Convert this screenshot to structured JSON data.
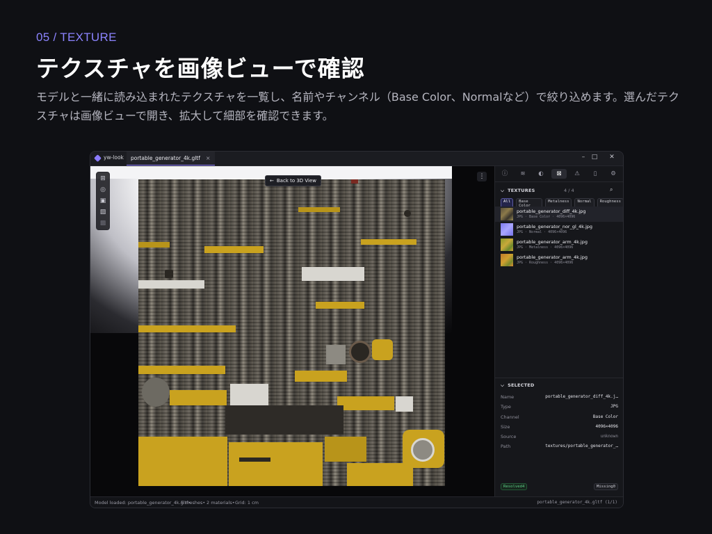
{
  "hero": {
    "kicker": "05 / TEXTURE",
    "title": "テクスチャを画像ビューで確認",
    "description": "モデルと一緒に読み込まれたテクスチャを一覧し、名前やチャンネル（Base Color、Normalなど）で絞り込めます。選んだテクスチャは画像ビューで開き、拡大して細部を確認できます。"
  },
  "window": {
    "app_name": "yw-look",
    "tab_title": "portable_generator_4k.gltf",
    "tab_close": "×",
    "controls": {
      "minimize": "–",
      "maximize": "□",
      "close": "✕"
    }
  },
  "viewport": {
    "back_button": "Back to 3D View",
    "back_icon": "←",
    "more_icon": "⋮",
    "tools": [
      {
        "name": "grid-icon",
        "glyph": "⊞"
      },
      {
        "name": "target-icon",
        "glyph": "◎"
      },
      {
        "name": "image-icon",
        "glyph": "▣"
      },
      {
        "name": "image-alt-icon",
        "glyph": "▨"
      },
      {
        "name": "checker-icon",
        "glyph": "▩"
      }
    ]
  },
  "side_panel": {
    "tabs": [
      {
        "name": "info-icon",
        "glyph": "ⓘ"
      },
      {
        "name": "layers-icon",
        "glyph": "≋"
      },
      {
        "name": "material-icon",
        "glyph": "◐"
      },
      {
        "name": "texture-icon",
        "glyph": "⊠"
      },
      {
        "name": "warning-icon",
        "glyph": "⚠"
      },
      {
        "name": "file-icon",
        "glyph": "▯"
      },
      {
        "name": "settings-icon",
        "glyph": "⚙"
      }
    ],
    "textures_section": {
      "title": "TEXTURES",
      "chevron": "⌵",
      "count": "4 / 4",
      "search_icon": "⌕",
      "filters": [
        "All",
        "Base Color",
        "Metalness",
        "Normal",
        "Roughness"
      ],
      "active_filter": "All",
      "items": [
        {
          "name": "portable_generator_diff_4k.jpg",
          "meta": "JPG · Base Color · 4096×4096",
          "thumb_color": "#8c7a4a"
        },
        {
          "name": "portable_generator_nor_gl_4k.jpg",
          "meta": "JPG · Normal · 4096×4096",
          "thumb_color": "#8a86f0"
        },
        {
          "name": "portable_generator_arm_4k.jpg",
          "meta": "JPG · Metalness · 4096×4096",
          "thumb_color": "#b9a23a"
        },
        {
          "name": "portable_generator_arm_4k.jpg",
          "meta": "JPG · Roughness · 4096×4096",
          "thumb_color": "#c88a2a"
        }
      ]
    },
    "selected_section": {
      "title": "SELECTED",
      "chevron": "⌵",
      "properties": [
        {
          "label": "Name",
          "value": "portable_generator_diff_4k.j…"
        },
        {
          "label": "Type",
          "value": "JPG"
        },
        {
          "label": "Channel",
          "value": "Base Color"
        },
        {
          "label": "Size",
          "value": "4096×4096"
        },
        {
          "label": "Source",
          "value": "unknown"
        },
        {
          "label": "Path",
          "value": "textures/portable_generator_…"
        }
      ],
      "resolved_badge": "Resolved4",
      "missing_badge": "Missing0"
    }
  },
  "status_bar": {
    "model_loaded": "Model loaded: portable_generator_4k.gltf•",
    "meshes": "5 meshes•",
    "materials": "2 materials•",
    "grid": "Grid: 1 cm",
    "file_counter": "portable_generator_4k.gltf (1/1)"
  },
  "colors": {
    "accent": "#8b7bff",
    "background": "#0f1014",
    "texture_yellow": "#c9a21f",
    "resolved_green": "#5fd18a"
  }
}
